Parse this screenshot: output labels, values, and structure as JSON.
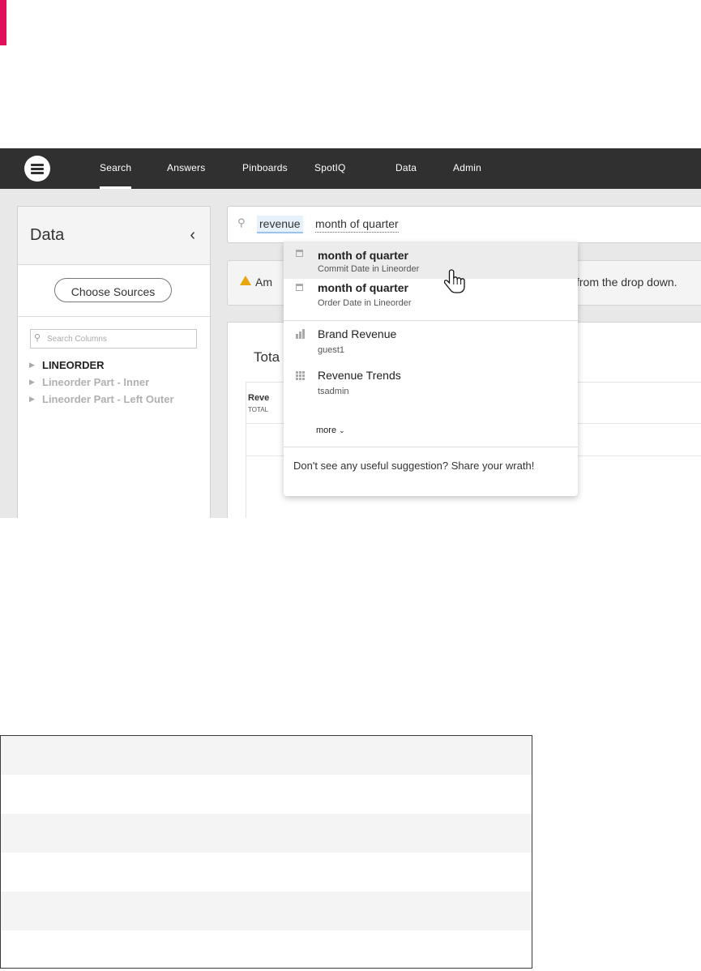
{
  "nav": {
    "logo_icon": "thoughtspot-logo",
    "items": [
      "Search",
      "Answers",
      "Pinboards",
      "SpotIQ",
      "Data",
      "Admin"
    ],
    "active": "Search"
  },
  "data_panel": {
    "title": "Data",
    "collapse_icon": "chevron-left-icon",
    "choose_sources": "Choose Sources",
    "search_placeholder": "Search Columns",
    "sources": [
      "LINEORDER",
      "Lineorder Part - Inner",
      "Lineorder Part - Left Outer"
    ]
  },
  "search": {
    "tokens": [
      "revenue",
      "month of quarter"
    ]
  },
  "warning": {
    "text_left": "Am",
    "text_right": "from the drop down.",
    "icon": "warning-triangle-icon",
    "color": "#e8a50c"
  },
  "card": {
    "title": "Tota",
    "column_header": "Reve",
    "column_sub": "TOTAL"
  },
  "dropdown": {
    "items": [
      {
        "title": "month of quarter",
        "subtitle": "Commit Date in Lineorder",
        "icon": "calendar-icon"
      },
      {
        "title": "month of quarter",
        "subtitle": "Order Date in Lineorder",
        "icon": "calendar-icon"
      },
      {
        "title": "Brand Revenue",
        "subtitle": "guest1",
        "icon": "bar-chart-icon"
      },
      {
        "title": "Revenue Trends",
        "subtitle": "tsadmin",
        "icon": "grid-icon"
      }
    ],
    "more": "more",
    "footer": "Don't see any useful suggestion? Share your wrath!"
  },
  "colors": {
    "nav_bg": "#303030",
    "accent_pink": "#e0105a",
    "token_highlight": "#e7f1fb"
  }
}
